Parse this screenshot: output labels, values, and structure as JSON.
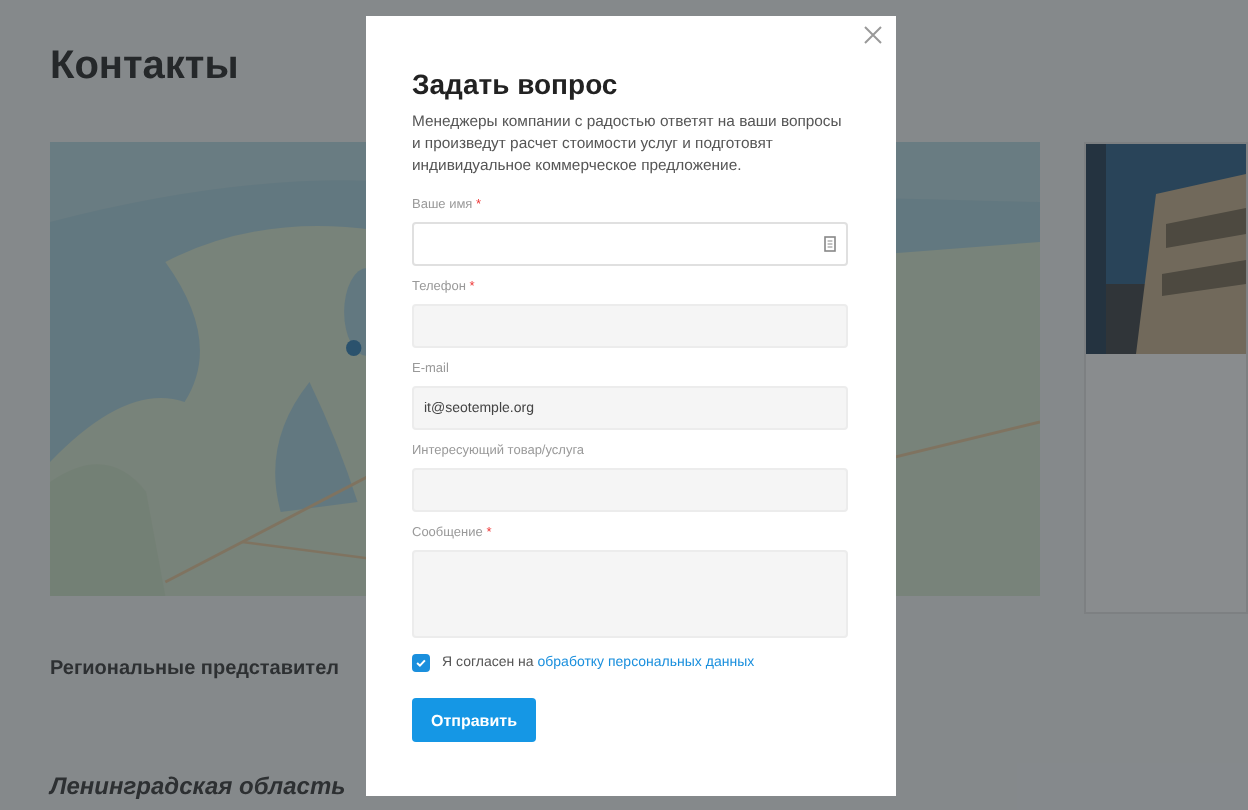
{
  "page": {
    "title": "Контакты",
    "section_heading": "Региональные представител",
    "region_heading": "Ленинградская область"
  },
  "modal": {
    "title": "Задать вопрос",
    "description": "Менеджеры компании с радостью ответят на ваши вопросы и произведут расчет стоимости услуг и подготовят индивидуальное коммерческое предложение.",
    "fields": [
      {
        "label": "Ваше имя",
        "required_mark": "*",
        "kind": "input",
        "focused": true
      },
      {
        "label": "Телефон",
        "required_mark": "*",
        "kind": "input",
        "focused": false
      },
      {
        "label": "E-mail",
        "kind": "input",
        "focused": false,
        "value": "it@seotemple.org"
      },
      {
        "label": "Интересующий товар/услуга",
        "kind": "input",
        "focused": false
      },
      {
        "label": "Сообщение",
        "required_mark": "*",
        "kind": "textarea",
        "focused": false
      }
    ],
    "consent": {
      "checked": true,
      "text": "Я согласен на",
      "link": "обработку персональных данных"
    },
    "submit": "Отправить"
  }
}
